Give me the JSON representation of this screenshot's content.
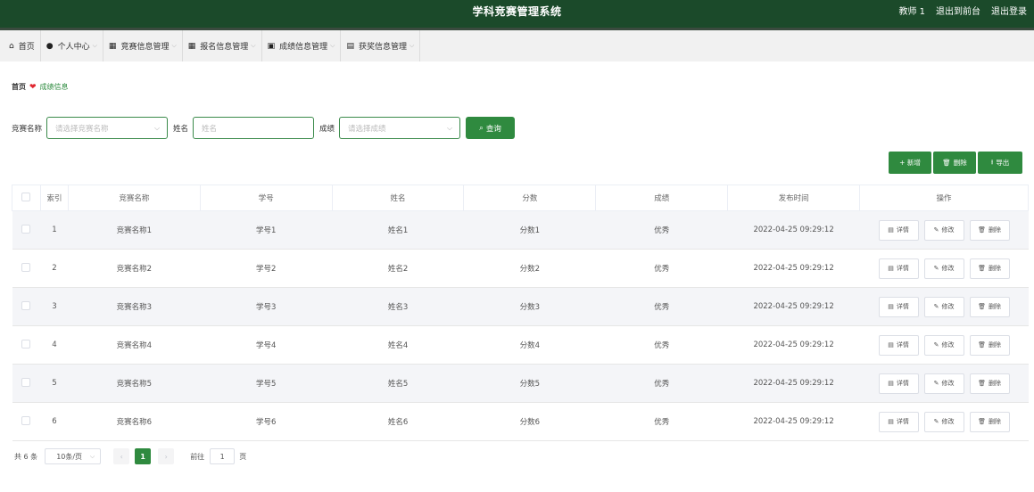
{
  "app": {
    "title": "学科竞赛管理系统"
  },
  "header": {
    "user": "教师 1",
    "front_link": "退出到前台",
    "logout_link": "退出登录"
  },
  "nav": [
    {
      "label": "首页",
      "icon": "home-icon",
      "glyph": "⌂",
      "has_menu": false
    },
    {
      "label": "个人中心",
      "icon": "user-icon",
      "glyph": "●",
      "has_menu": true
    },
    {
      "label": "竞赛信息管理",
      "icon": "grid-icon",
      "glyph": "▦",
      "has_menu": true
    },
    {
      "label": "报名信息管理",
      "icon": "grid-icon",
      "glyph": "▦",
      "has_menu": true
    },
    {
      "label": "成绩信息管理",
      "icon": "square-icon",
      "glyph": "▣",
      "has_menu": true
    },
    {
      "label": "获奖信息管理",
      "icon": "chart-icon",
      "glyph": "▤",
      "has_menu": true
    }
  ],
  "breadcrumb": {
    "home": "首页",
    "current": "成绩信息"
  },
  "search": {
    "comp_label": "竞赛名称",
    "comp_placeholder": "请选择竞赛名称",
    "name_label": "姓名",
    "name_placeholder": "姓名",
    "grade_label": "成绩",
    "grade_placeholder": "请选择成绩",
    "query_label": "查询"
  },
  "toolbar": {
    "add": "+ 新增",
    "delete": "删除",
    "export": "导出"
  },
  "table": {
    "headers": [
      "索引",
      "竞赛名称",
      "学号",
      "姓名",
      "分数",
      "成绩",
      "发布时间",
      "操作"
    ],
    "rows": [
      {
        "index": "1",
        "comp": "竞赛名称1",
        "sid": "学号1",
        "name": "姓名1",
        "score": "分数1",
        "grade": "优秀",
        "time": "2022-04-25 09:29:12"
      },
      {
        "index": "2",
        "comp": "竞赛名称2",
        "sid": "学号2",
        "name": "姓名2",
        "score": "分数2",
        "grade": "优秀",
        "time": "2022-04-25 09:29:12"
      },
      {
        "index": "3",
        "comp": "竞赛名称3",
        "sid": "学号3",
        "name": "姓名3",
        "score": "分数3",
        "grade": "优秀",
        "time": "2022-04-25 09:29:12"
      },
      {
        "index": "4",
        "comp": "竞赛名称4",
        "sid": "学号4",
        "name": "姓名4",
        "score": "分数4",
        "grade": "优秀",
        "time": "2022-04-25 09:29:12"
      },
      {
        "index": "5",
        "comp": "竞赛名称5",
        "sid": "学号5",
        "name": "姓名5",
        "score": "分数5",
        "grade": "优秀",
        "time": "2022-04-25 09:29:12"
      },
      {
        "index": "6",
        "comp": "竞赛名称6",
        "sid": "学号6",
        "name": "姓名6",
        "score": "分数6",
        "grade": "优秀",
        "time": "2022-04-25 09:29:12"
      }
    ],
    "actions": {
      "detail": "详情",
      "edit": "修改",
      "delete": "删除"
    }
  },
  "pagination": {
    "total": "共 6 条",
    "page_size": "10条/页",
    "current": "1",
    "goto": "前往",
    "goto_value": "1",
    "unit": "页"
  },
  "colors": {
    "header_bg": "#1b4a2a",
    "primary": "#2f8a3f",
    "accent_red": "#e0262f"
  }
}
